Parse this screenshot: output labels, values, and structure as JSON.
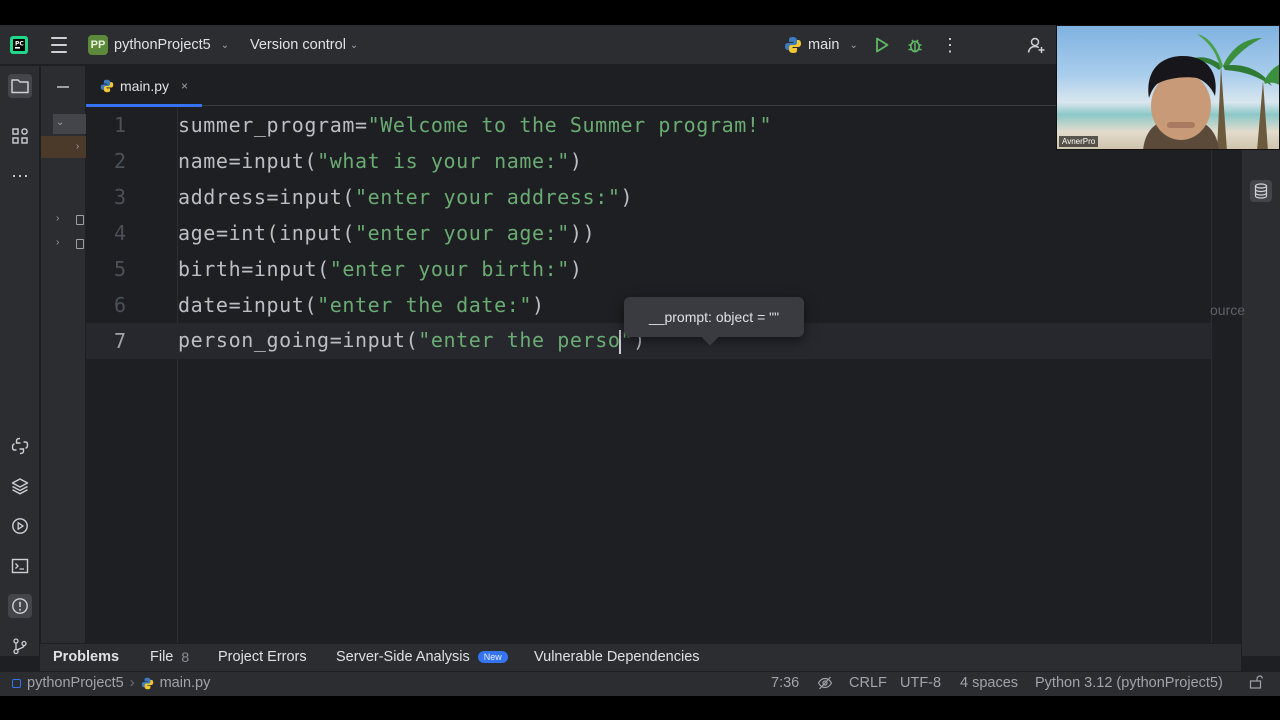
{
  "titlebar": {
    "project_badge": "PP",
    "project_name": "pythonProject5",
    "vcs_label": "Version control",
    "branch": "main"
  },
  "tab": {
    "file_name": "main.py",
    "close": "×"
  },
  "editor": {
    "lines": [
      {
        "num": "1",
        "ident": "summer_program",
        "op": "=",
        "str": "\"Welcome to the Summer program!\""
      },
      {
        "num": "2",
        "ident": "name",
        "op": "=",
        "call": "input(",
        "str": "\"what is your name:\"",
        "tail": ")"
      },
      {
        "num": "3",
        "ident": "address",
        "op": "=",
        "call": "input(",
        "str": "\"enter your address:\"",
        "tail": ")"
      },
      {
        "num": "4",
        "ident": "age",
        "op": "=",
        "call": "int(input(",
        "str": "\"enter your age:\"",
        "tail": "))"
      },
      {
        "num": "5",
        "ident": "birth",
        "op": "=",
        "call": "input(",
        "str": "\"enter your birth:\"",
        "tail": ")"
      },
      {
        "num": "6",
        "ident": "date",
        "op": "=",
        "call": "input(",
        "str": "\"enter the date:\"",
        "tail": ")"
      },
      {
        "num": "7",
        "ident": "person_going",
        "op": "=",
        "call": "input(",
        "str_before": "\"enter the perso",
        "str_after": "\"",
        "tail": ")"
      }
    ],
    "tooltip": "__prompt: object = \"\"",
    "cut_text": "ource"
  },
  "problems": {
    "tabs": [
      {
        "label": "Problems"
      },
      {
        "label": "File",
        "count": "8"
      },
      {
        "label": "Project Errors"
      },
      {
        "label": "Server-Side Analysis",
        "badge": "New"
      },
      {
        "label": "Vulnerable Dependencies"
      }
    ]
  },
  "status": {
    "crumb_project": "pythonProject5",
    "crumb_file": "main.py",
    "position": "7:36",
    "line_sep": "CRLF",
    "encoding": "UTF-8",
    "indent": "4 spaces",
    "interpreter": "Python 3.12 (pythonProject5)"
  },
  "webcam": {
    "name": "AvnerPro"
  },
  "colors": {
    "accent": "#3574f0",
    "string": "#6aab73",
    "background": "#1e1f22",
    "panel": "#2b2d30"
  }
}
